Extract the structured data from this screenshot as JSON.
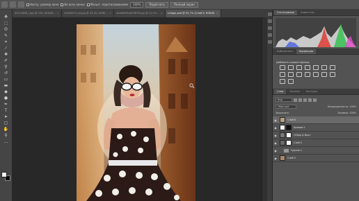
{
  "options_bar": {
    "items": [
      {
        "kind": "check",
        "label": "Настр. размер окна"
      },
      {
        "kind": "check",
        "label": "Во всех окнах"
      },
      {
        "kind": "check",
        "label": "Масшт. перетаскиванием"
      },
      {
        "kind": "select",
        "label": "100%"
      },
      {
        "kind": "button",
        "label": "Подогнать"
      },
      {
        "kind": "button",
        "label": "Полный экран"
      }
    ]
  },
  "tabs": [
    {
      "label": "4537c886_l.jpg @ 25% (RGB/8...",
      "active": false
    },
    {
      "label": "2246d475_ed.jpg @ 33,3% (RGB/...",
      "active": false
    },
    {
      "label": "4ee8d6f5c8e76f39.jpg @ 12,5%...",
      "active": false
    },
    {
      "label": "collage.psd @ 52,7% (Слой 6, RGB/8)",
      "active": true
    }
  ],
  "panels": {
    "top_tabs": [
      "Гистограмма",
      "Навигатор"
    ],
    "mid_tabs": [
      "Библиотеки",
      "Коррекция"
    ],
    "mid_active": "Коррекция",
    "adjust_title": "Добавить корректировку",
    "layers_tabs": [
      "Слои",
      "Каналы",
      "Контуры"
    ],
    "filter_label": "Вид",
    "blend_mode": "Обычные",
    "opacity_label": "Непрозрачность: 100%",
    "lock_label": "Закрепить:",
    "fill_label": "Заливка: 100%",
    "layers": [
      {
        "name": "Слой 6",
        "type": "layer",
        "selected": true
      },
      {
        "name": "Кривые 1",
        "type": "adjustment",
        "selected": false
      },
      {
        "name": "Отбор & Выст",
        "type": "adjustment",
        "selected": false
      },
      {
        "name": "Слой 5",
        "type": "layer",
        "selected": false
      },
      {
        "name": "Группа 1",
        "type": "group",
        "selected": false
      },
      {
        "name": "Слой 2",
        "type": "layer",
        "selected": false
      }
    ]
  },
  "colors": {
    "accent": "#6a6a6a",
    "foreground": "#f2f2f2",
    "background": "#0b0b0b"
  }
}
